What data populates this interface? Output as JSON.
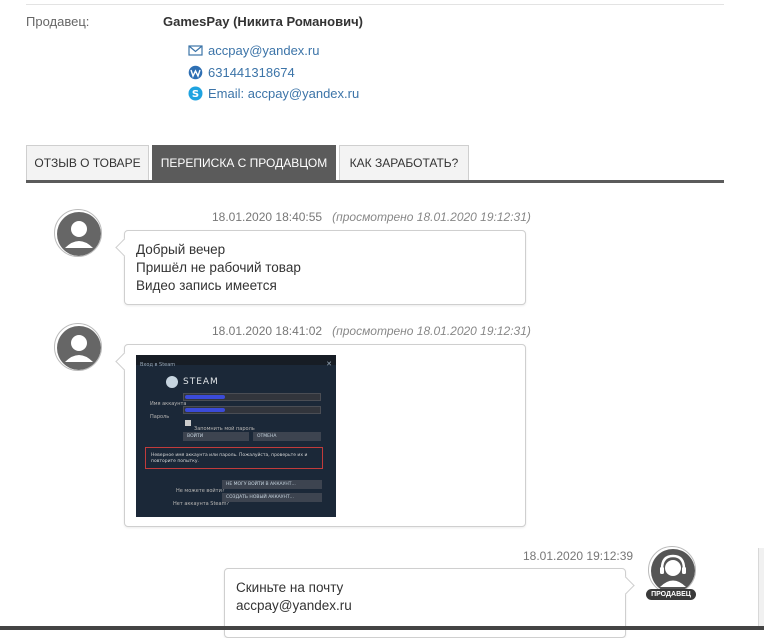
{
  "seller": {
    "label": "Продавец:",
    "name": "GamesPay (Никита Романович)",
    "contacts": [
      {
        "icon": "envelope-icon",
        "text": "accpay@yandex.ru"
      },
      {
        "icon": "webmoney-icon",
        "text": "631441318674"
      },
      {
        "icon": "skype-icon",
        "text": "Email: accpay@yandex.ru"
      }
    ]
  },
  "tabs": [
    {
      "label": "ОТЗЫВ О ТОВАРЕ",
      "active": false
    },
    {
      "label": "ПЕРЕПИСКА С ПРОДАВЦОМ",
      "active": true
    },
    {
      "label": "КАК ЗАРАБОТАТЬ?",
      "active": false
    }
  ],
  "messages": [
    {
      "time": "18.01.2020 18:40:55",
      "viewed": "(просмотрено 18.01.2020 19:12:31)",
      "lines": [
        "Добрый вечер",
        "Пришёл не рабочий товар",
        "Видео запись имеется"
      ]
    },
    {
      "time": "18.01.2020 18:41:02",
      "viewed": "(просмотрено 18.01.2020 19:12:31)",
      "attachment": {
        "window_title": "Вход в Steam",
        "close": "✕",
        "logo": "STEAM",
        "account_label": "Имя аккаунта",
        "password_label": "Пароль",
        "remember": "Запомнить мой пароль",
        "login_btn": "ВОЙТИ",
        "cancel_btn": "ОТМЕНА",
        "error": "Неверное имя аккаунта или пароль. Пожалуйста, проверьте их и повторите попытку.",
        "cant_login_label": "Не можете войти?",
        "cant_login_btn": "НЕ МОГУ ВОЙТИ В АККАУНТ...",
        "no_account_label": "Нет аккаунта Steam?",
        "create_btn": "СОЗДАТЬ НОВЫЙ АККАУНТ..."
      }
    },
    {
      "time": "18.01.2020 19:12:39",
      "lines": [
        "Скиньте на почту",
        "accpay@yandex.ru"
      ],
      "badge": "ПРОДАВЕЦ"
    }
  ]
}
